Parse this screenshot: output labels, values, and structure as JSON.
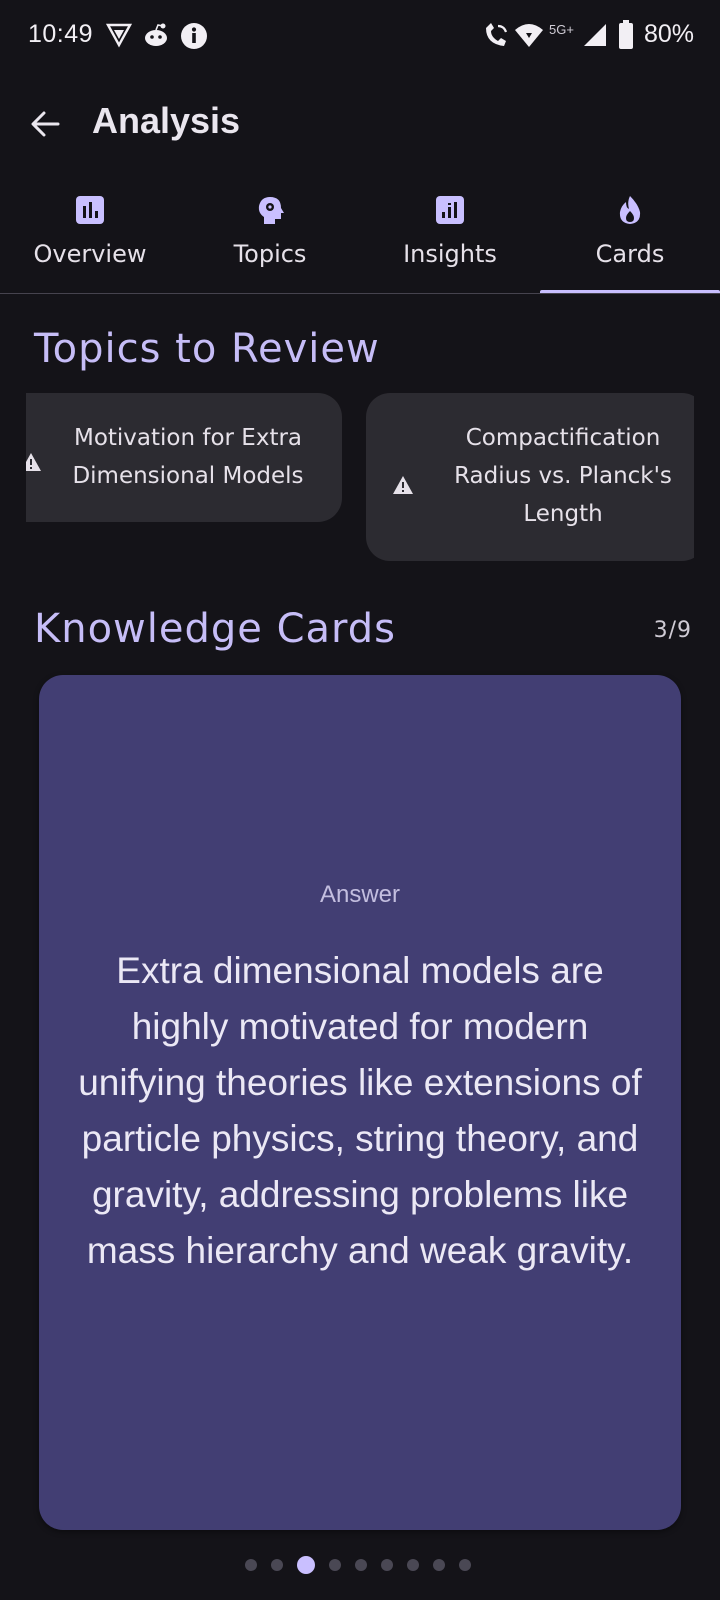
{
  "status_bar": {
    "time": "10:49",
    "network": "5G+",
    "battery": "80%",
    "icons": [
      "vpn-shield-icon",
      "reddit-icon",
      "info-icon",
      "wifi-calling-icon",
      "wifi-icon",
      "signal-icon",
      "battery-icon"
    ]
  },
  "header": {
    "title": "Analysis",
    "back_icon": "arrow-back-icon"
  },
  "tabs": [
    {
      "label": "Overview",
      "icon": "bar-chart-icon",
      "selected": false
    },
    {
      "label": "Topics",
      "icon": "head-gear-icon",
      "selected": false
    },
    {
      "label": "Insights",
      "icon": "analytics-icon",
      "selected": false
    },
    {
      "label": "Cards",
      "icon": "flame-icon",
      "selected": true
    }
  ],
  "topics_section": {
    "title": "Topics to Review",
    "chips": [
      {
        "line1": "Motivation for Extra",
        "line2": "Dimensional Models",
        "icon": "warning-icon"
      },
      {
        "line1": "Compactification",
        "line2": "Radius vs. Planck's",
        "line3": "Length",
        "icon": "warning-icon"
      }
    ]
  },
  "cards_section": {
    "title": "Knowledge Cards",
    "count": "3/9",
    "card": {
      "kicker": "Answer",
      "body": "Extra dimensional models are highly motivated for modern unifying theories like extensions of particle physics, string theory, and gravity, addressing problems like mass hierarchy and weak gravity."
    },
    "pager": {
      "total": 9,
      "active_index": 2
    }
  },
  "colors": {
    "background": "#141318",
    "accent": "#c9bfff",
    "card": "#423e73",
    "chip": "#2c2b31"
  }
}
